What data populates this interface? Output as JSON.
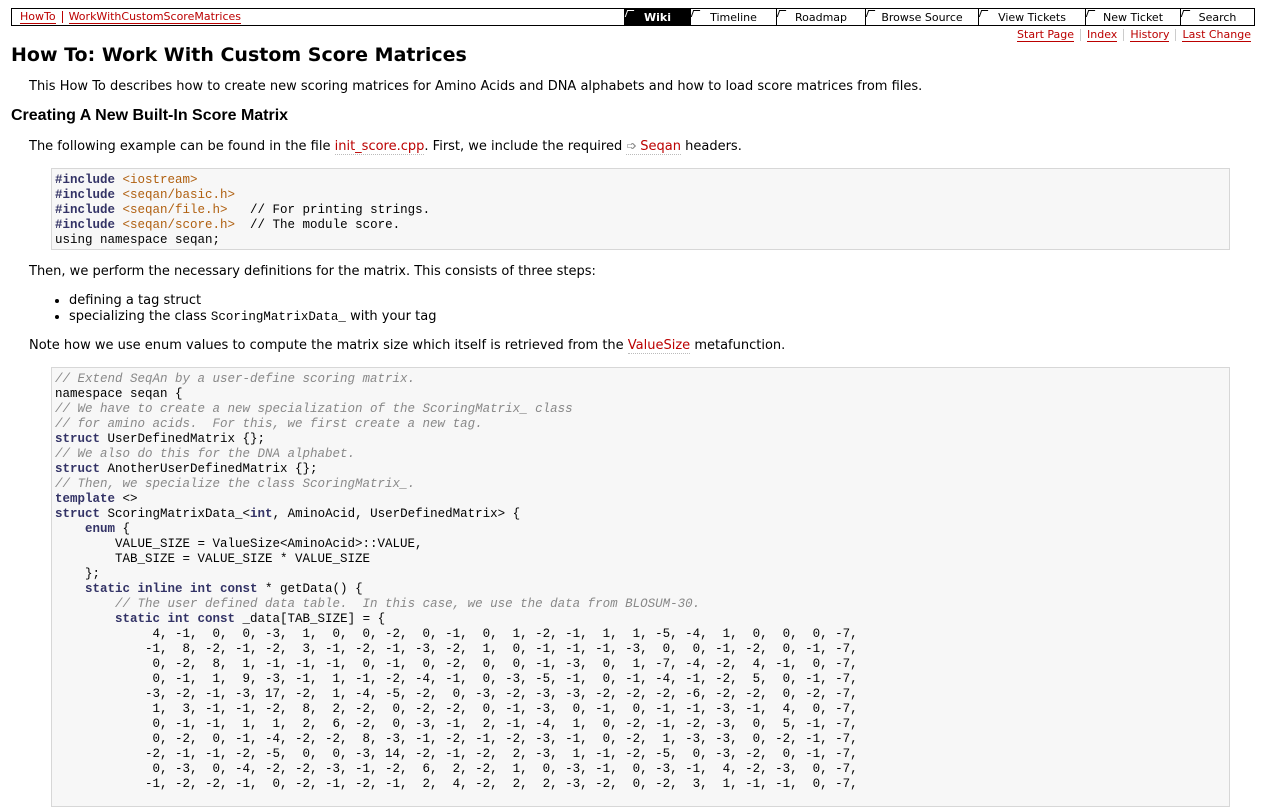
{
  "context_nav": [
    "HowTo",
    "WorkWithCustomScoreMatrices"
  ],
  "main_nav": [
    {
      "label": "Wiki",
      "active": true,
      "width": 66
    },
    {
      "label": "Timeline",
      "active": false,
      "width": 86
    },
    {
      "label": "Roadmap",
      "active": false,
      "width": 89
    },
    {
      "label": "Browse Source",
      "active": false,
      "width": 113
    },
    {
      "label": "View Tickets",
      "active": false,
      "width": 107
    },
    {
      "label": "New Ticket",
      "active": false,
      "width": 95
    },
    {
      "label": "Search",
      "active": false,
      "width": 74
    }
  ],
  "sub_nav": [
    "Start Page",
    "Index",
    "History",
    "Last Change"
  ],
  "page_title": "How To: Work With Custom Score Matrices",
  "intro": "This How To describes how to create new scoring matrices for Amino Acids and DNA alphabets and how to load score matrices from files.",
  "section_title": "Creating A New Built-In Score Matrix",
  "example_para": {
    "before": "The following example can be found in the file ",
    "file_link": "init_score.cpp",
    "middle": ". First, we include the required ",
    "seqan_link": "Seqan",
    "after": " headers."
  },
  "code1": [
    [
      [
        "pp",
        "#include "
      ],
      [
        "s",
        "<iostream>"
      ]
    ],
    [
      [
        "pp",
        "#include "
      ],
      [
        "s",
        "<seqan/basic.h>"
      ]
    ],
    [
      [
        "pp",
        "#include "
      ],
      [
        "s",
        "<seqan/file.h>"
      ],
      [
        "t",
        "   // For printing strings."
      ]
    ],
    [
      [
        "pp",
        "#include "
      ],
      [
        "s",
        "<seqan/score.h>"
      ],
      [
        "t",
        "  // The module score."
      ]
    ],
    [
      [
        "t",
        "using namespace seqan;"
      ]
    ]
  ],
  "steps_para": "Then, we perform the necessary definitions for the matrix. This consists of three steps:",
  "bullets": [
    {
      "text": "defining a tag struct",
      "code": "",
      "after": ""
    },
    {
      "text": "specializing the class ",
      "code": "ScoringMatrixData_",
      "after": " with your tag"
    }
  ],
  "note_para": {
    "before": "Note how we use enum values to compute the matrix size which itself is retrieved from the ",
    "link": "ValueSize",
    "after": " metafunction."
  },
  "code2": [
    [
      [
        "c",
        "// Extend SeqAn by a user-define scoring matrix."
      ]
    ],
    [
      [
        "t",
        "namespace seqan {"
      ]
    ],
    [
      [
        "c",
        "// We have to create a new specialization of the ScoringMatrix_ class"
      ]
    ],
    [
      [
        "c",
        "// for amino acids.  For this, we first create a new tag."
      ]
    ],
    [
      [
        "k",
        "struct"
      ],
      [
        "t",
        " UserDefinedMatrix {};"
      ]
    ],
    [
      [
        "c",
        "// We also do this for the DNA alphabet."
      ]
    ],
    [
      [
        "k",
        "struct"
      ],
      [
        "t",
        " AnotherUserDefinedMatrix {};"
      ]
    ],
    [
      [
        "c",
        "// Then, we specialize the class ScoringMatrix_."
      ]
    ],
    [
      [
        "k",
        "template"
      ],
      [
        "t",
        " <>"
      ]
    ],
    [
      [
        "k",
        "struct"
      ],
      [
        "t",
        " ScoringMatrixData_<"
      ],
      [
        "k",
        "int"
      ],
      [
        "t",
        ", AminoAcid, UserDefinedMatrix> {"
      ]
    ],
    [
      [
        "t",
        "    "
      ],
      [
        "k",
        "enum"
      ],
      [
        "t",
        " {"
      ]
    ],
    [
      [
        "t",
        "        VALUE_SIZE = ValueSize<AminoAcid>::VALUE,"
      ]
    ],
    [
      [
        "t",
        "        TAB_SIZE = VALUE_SIZE * VALUE_SIZE"
      ]
    ],
    [
      [
        "t",
        "    };"
      ]
    ],
    [
      [
        "t",
        "    "
      ],
      [
        "k",
        "static inline int const"
      ],
      [
        "t",
        " * getData() {"
      ]
    ],
    [
      [
        "t",
        "        "
      ],
      [
        "c",
        "// The user defined data table.  In this case, we use the data from BLOSUM-30."
      ]
    ],
    [
      [
        "t",
        "        "
      ],
      [
        "k",
        "static int const"
      ],
      [
        "t",
        " _data[TAB_SIZE] = {"
      ]
    ],
    [
      [
        "t",
        "             4, -1,  0,  0, -3,  1,  0,  0, -2,  0, -1,  0,  1, -2, -1,  1,  1, -5, -4,  1,  0,  0,  0, -7,"
      ]
    ],
    [
      [
        "t",
        "            -1,  8, -2, -1, -2,  3, -1, -2, -1, -3, -2,  1,  0, -1, -1, -1, -3,  0,  0, -1, -2,  0, -1, -7,"
      ]
    ],
    [
      [
        "t",
        "             0, -2,  8,  1, -1, -1, -1,  0, -1,  0, -2,  0,  0, -1, -3,  0,  1, -7, -4, -2,  4, -1,  0, -7,"
      ]
    ],
    [
      [
        "t",
        "             0, -1,  1,  9, -3, -1,  1, -1, -2, -4, -1,  0, -3, -5, -1,  0, -1, -4, -1, -2,  5,  0, -1, -7,"
      ]
    ],
    [
      [
        "t",
        "            -3, -2, -1, -3, 17, -2,  1, -4, -5, -2,  0, -3, -2, -3, -3, -2, -2, -2, -6, -2, -2,  0, -2, -7,"
      ]
    ],
    [
      [
        "t",
        "             1,  3, -1, -1, -2,  8,  2, -2,  0, -2, -2,  0, -1, -3,  0, -1,  0, -1, -1, -3, -1,  4,  0, -7,"
      ]
    ],
    [
      [
        "t",
        "             0, -1, -1,  1,  1,  2,  6, -2,  0, -3, -1,  2, -1, -4,  1,  0, -2, -1, -2, -3,  0,  5, -1, -7,"
      ]
    ],
    [
      [
        "t",
        "             0, -2,  0, -1, -4, -2, -2,  8, -3, -1, -2, -1, -2, -3, -1,  0, -2,  1, -3, -3,  0, -2, -1, -7,"
      ]
    ],
    [
      [
        "t",
        "            -2, -1, -1, -2, -5,  0,  0, -3, 14, -2, -1, -2,  2, -3,  1, -1, -2, -5,  0, -3, -2,  0, -1, -7,"
      ]
    ],
    [
      [
        "t",
        "             0, -3,  0, -4, -2, -2, -3, -1, -2,  6,  2, -2,  1,  0, -3, -1,  0, -3, -1,  4, -2, -3,  0, -7,"
      ]
    ],
    [
      [
        "t",
        "            -1, -2, -2, -1,  0, -2, -1, -2, -1,  2,  4, -2,  2,  2, -3, -2,  0, -2,  3,  1, -1, -1,  0, -7,"
      ]
    ]
  ]
}
